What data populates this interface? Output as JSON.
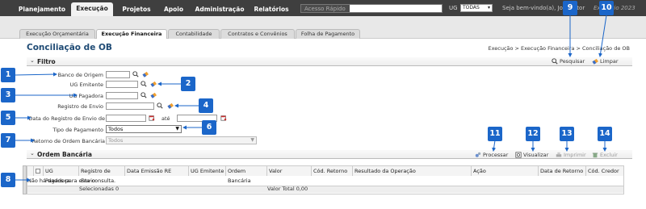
{
  "topnav": {
    "tabs": [
      "Planejamento",
      "Execução",
      "Projetos",
      "Apoio",
      "Administração",
      "Relatórios"
    ],
    "quick_access_label": "Acesso Rápido",
    "ug_label": "UG",
    "ug_value": "TODAS",
    "welcome": "Seja bem-vindo(a), Joao Vitor",
    "year": "Exercício 2023"
  },
  "subnav": {
    "tabs": [
      "Execução Orçamentária",
      "Execução Financeira",
      "Contabilidade",
      "Contratos e Convênios",
      "Folha de Pagamento"
    ]
  },
  "page": {
    "title": "Conciliação de OB",
    "breadcrumb": "Execução > Execução Financeira > Conciliação de OB"
  },
  "filter": {
    "title": "Filtro",
    "pesquisar": "Pesquisar",
    "limpar": "Limpar",
    "labels": {
      "banco": "* Banco de Origem",
      "ug_emitente": "UG Emitente",
      "ug_pagadora": "UG Pagadora",
      "registro": "Registro de Envio",
      "data_registro": "Data do Registro de Envio de",
      "ate": "até",
      "tipo_pagamento": "Tipo de Pagamento",
      "retorno": "Retorno de Ordem Bancária"
    },
    "tipo_pagamento_value": "Todos",
    "retorno_value": "Todos"
  },
  "ordem": {
    "title": "Ordem Bancária",
    "processar": "Processar",
    "visualizar": "Visualizar",
    "imprimir": "Imprimir",
    "excluir": "Excluir",
    "columns": [
      "UG Pagadora",
      "Registro de Envio",
      "Data Emissão RE",
      "UG Emitente",
      "Ordem Bancária",
      "Valor",
      "Cód. Retorno",
      "Resultado da Operação",
      "Ação",
      "Data de Retorno",
      "Cód. Credor"
    ],
    "empty": "Não há dados para esta consulta.",
    "selecionadas_label": "Selecionadas",
    "selecionadas_value": "0",
    "valor_total_label": "Valor Total",
    "valor_total_value": "0,00"
  },
  "callouts": [
    "1",
    "2",
    "3",
    "4",
    "5",
    "6",
    "7",
    "8",
    "9",
    "10",
    "11",
    "12",
    "13",
    "14"
  ],
  "colors": {
    "accent": "#1b66c9",
    "title": "#1e4a74",
    "topnav": "#3f3f3f"
  }
}
